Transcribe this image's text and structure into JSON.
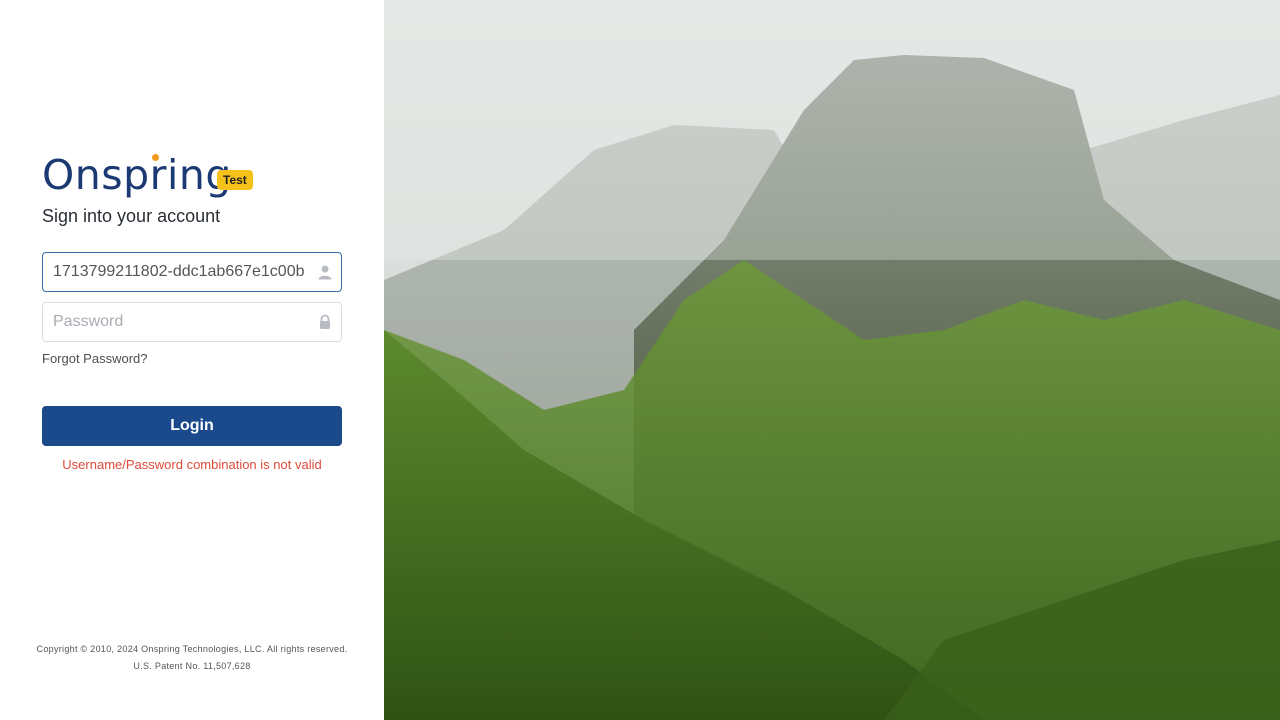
{
  "brand": {
    "name": "Onspring",
    "badge": "Test",
    "dot_color": "#f29a1d"
  },
  "login": {
    "subtitle": "Sign into your account",
    "username_value": "1713799211802-ddc1ab667e1c00b",
    "password_placeholder": "Password",
    "forgot_label": "Forgot Password?",
    "button_label": "Login",
    "error_message": "Username/Password combination is not valid"
  },
  "footer": {
    "copyright": "Copyright © 2010, 2024 Onspring Technologies, LLC. All rights reserved.",
    "patent": "U.S. Patent No. 11,507,628"
  },
  "colors": {
    "primary": "#1b4a8c",
    "brand_text": "#1b3a73",
    "badge": "#f5c21b",
    "error": "#e04a3a"
  },
  "icons": {
    "username": "user-icon",
    "password": "lock-icon"
  }
}
